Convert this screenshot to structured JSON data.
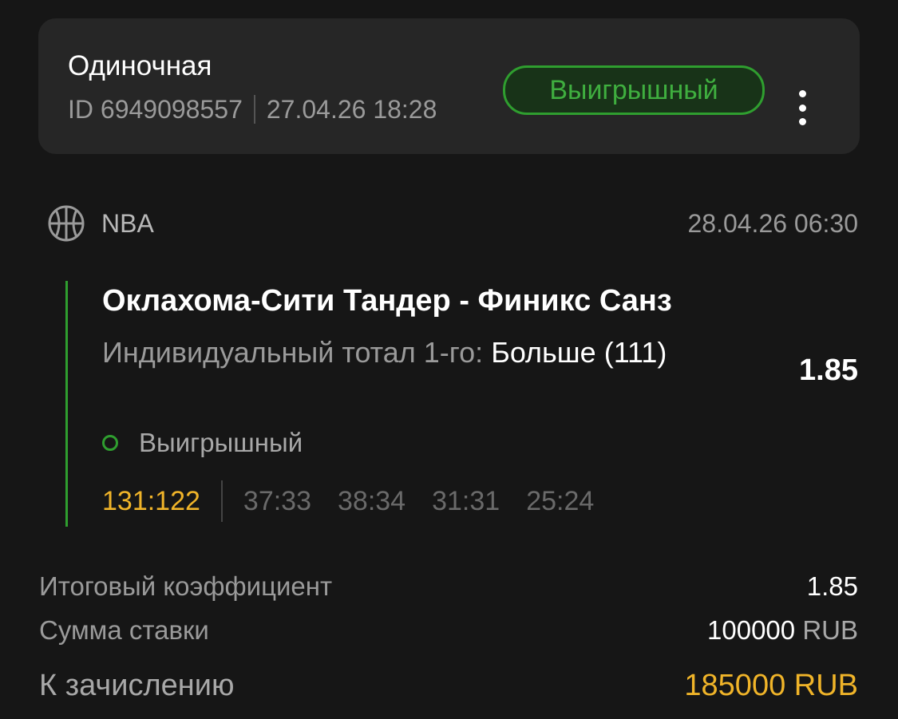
{
  "header": {
    "bet_type": "Одиночная",
    "id_label": "ID 6949098557",
    "placed_at": "27.04.26 18:28",
    "status": "Выигрышный",
    "more_icon": "more-vertical-icon"
  },
  "event": {
    "sport_icon": "basketball-icon",
    "league": "NBA",
    "start_time": "28.04.26 06:30",
    "match": "Оклахома-Сити Тандер - Финикс Санз",
    "market_name": "Индивидуальный тотал 1-го:",
    "selection": "Больше (111)",
    "odds": "1.85",
    "selection_status": "Выигрышный",
    "final_score": "131:122",
    "quarter_scores": [
      "37:33",
      "38:34",
      "31:31",
      "25:24"
    ]
  },
  "summary": {
    "total_odds_label": "Итоговый коэффициент",
    "total_odds_value": "1.85",
    "stake_label": "Сумма ставки",
    "stake_amount": "100000",
    "stake_currency": "RUB",
    "payout_label": "К зачислению",
    "payout_value": "185000 RUB"
  },
  "colors": {
    "background": "#161616",
    "card": "#262626",
    "win_green": "#2f9e2f",
    "accent_gold": "#f0b429"
  }
}
